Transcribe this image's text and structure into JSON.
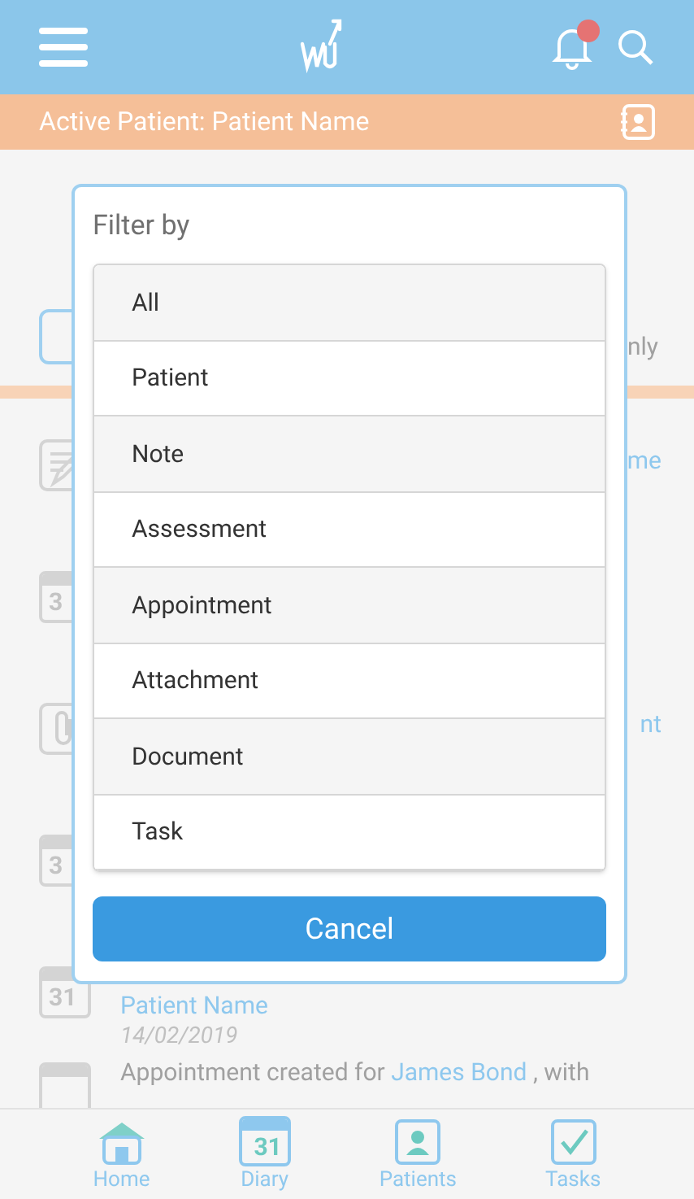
{
  "header": {
    "notification_dot": true
  },
  "active_patient": {
    "text": "Active Patient: Patient Name"
  },
  "background": {
    "toggle_label_tail": "nly",
    "items": [
      {
        "kind": "note",
        "text_tail": "me"
      },
      {
        "kind": "calendar",
        "icon_text": "3"
      },
      {
        "kind": "attachment",
        "text_tail": "nt"
      },
      {
        "kind": "calendar",
        "icon_text": "3"
      },
      {
        "kind": "calendar",
        "icon_text": "31",
        "link": "Patient Name",
        "date": "14/02/2019"
      },
      {
        "kind": "calendar",
        "prefix": "Appointment created for ",
        "sentence_link": "James Bond",
        "suffix": " , with"
      }
    ]
  },
  "dialog": {
    "title": "Filter by",
    "options": [
      "All",
      "Patient",
      "Note",
      "Assessment",
      "Appointment",
      "Attachment",
      "Document",
      "Task"
    ],
    "cancel": "Cancel"
  },
  "nav": [
    {
      "kind": "home",
      "label": "Home"
    },
    {
      "kind": "diary",
      "label": "Diary",
      "icon_text": "31"
    },
    {
      "kind": "patients",
      "label": "Patients"
    },
    {
      "kind": "tasks",
      "label": "Tasks"
    }
  ]
}
